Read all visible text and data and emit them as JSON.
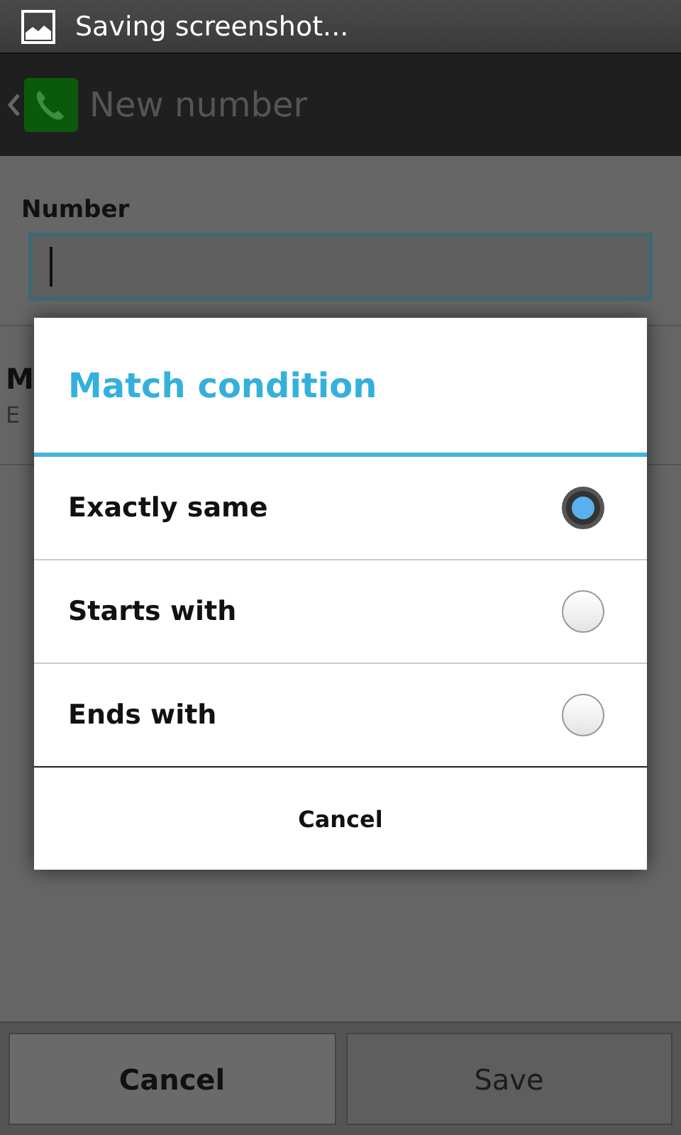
{
  "status_bar": {
    "notification": "Saving screenshot..."
  },
  "action_bar": {
    "title": "New number"
  },
  "form": {
    "number_label": "Number",
    "row_title": "M",
    "row_subtitle": "E"
  },
  "dialog": {
    "title": "Match condition",
    "options": [
      {
        "label": "Exactly same",
        "selected": true
      },
      {
        "label": "Starts with",
        "selected": false
      },
      {
        "label": "Ends with",
        "selected": false
      }
    ],
    "cancel": "Cancel"
  },
  "buttons": [
    {
      "label": "Cancel",
      "disabled": false
    },
    {
      "label": "Save",
      "disabled": true
    }
  ]
}
